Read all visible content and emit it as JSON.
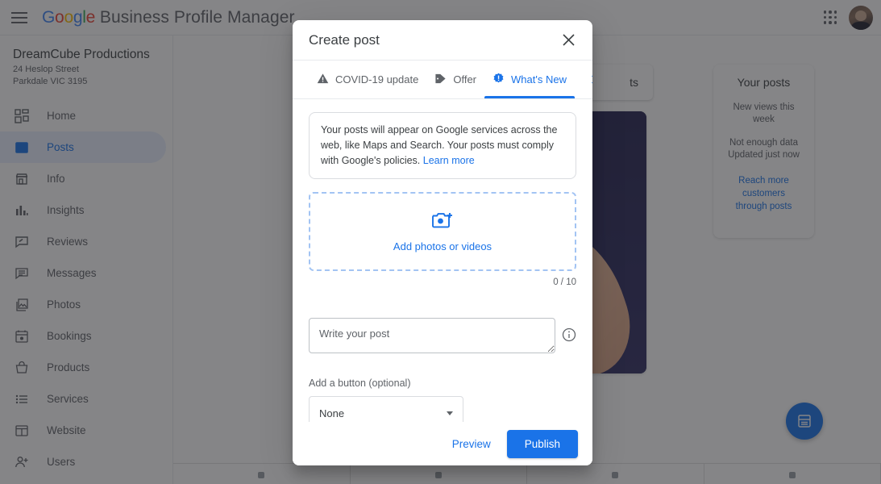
{
  "topbar": {
    "menu_icon": "hamburger-menu-icon",
    "logo_letters": [
      "G",
      "o",
      "o",
      "g",
      "l",
      "e"
    ],
    "brand_rest": " Business Profile Manager",
    "apps_icon": "apps-grid-icon",
    "avatar": "user-avatar"
  },
  "sidebar": {
    "business_name": "DreamCube Productions",
    "address_line1": "24 Heslop Street",
    "address_line2": "Parkdale VIC 3195",
    "items": [
      {
        "label": "Home",
        "icon": "home-dashboard-icon",
        "active": false
      },
      {
        "label": "Posts",
        "icon": "posts-icon",
        "active": true
      },
      {
        "label": "Info",
        "icon": "storefront-icon",
        "active": false
      },
      {
        "label": "Insights",
        "icon": "bar-chart-icon",
        "active": false
      },
      {
        "label": "Reviews",
        "icon": "review-star-icon",
        "active": false
      },
      {
        "label": "Messages",
        "icon": "message-icon",
        "active": false
      },
      {
        "label": "Photos",
        "icon": "photos-icon",
        "active": false
      },
      {
        "label": "Bookings",
        "icon": "calendar-icon",
        "active": false
      },
      {
        "label": "Products",
        "icon": "basket-icon",
        "active": false
      },
      {
        "label": "Services",
        "icon": "list-icon",
        "active": false
      },
      {
        "label": "Website",
        "icon": "web-layout-icon",
        "active": false
      },
      {
        "label": "Users",
        "icon": "add-person-icon",
        "active": false
      }
    ]
  },
  "background": {
    "search_tab_text": "ts",
    "posts_panel": {
      "title": "Your posts",
      "metric_label": "New views this week",
      "status": "Not enough data",
      "updated": "Updated just now",
      "cta_line1": "Reach more",
      "cta_line2": "customers",
      "cta_line3": "through posts"
    },
    "fab_icon": "create-post-icon"
  },
  "dialog": {
    "title": "Create post",
    "close_icon": "close-icon",
    "tabs": [
      {
        "label": "COVID-19 update",
        "icon": "warning-triangle-icon",
        "active": false
      },
      {
        "label": "Offer",
        "icon": "tag-icon",
        "active": false
      },
      {
        "label": "What's New",
        "icon": "new-badge-icon",
        "active": true
      }
    ],
    "tab_next_icon": "chevron-right-icon",
    "notice": {
      "text": "Your posts will appear on Google services across the web, like Maps and Search. Your posts must comply with Google's policies. ",
      "link": "Learn more"
    },
    "dropzone": {
      "icon": "add-photo-camera-icon",
      "label": "Add photos or videos",
      "counter": "0 / 10"
    },
    "post_input": {
      "value": "",
      "placeholder": "Write your post",
      "info_icon": "info-circle-icon"
    },
    "button_field": {
      "label": "Add a button (optional)",
      "selected": "None",
      "caret_icon": "chevron-down-icon"
    },
    "footer": {
      "preview_label": "Preview",
      "publish_label": "Publish"
    }
  },
  "colors": {
    "accent": "#1a73e8",
    "active_bg": "#e8f0fe",
    "text_primary": "#3c4043",
    "text_secondary": "#5f6368",
    "scrim": "#202124"
  }
}
